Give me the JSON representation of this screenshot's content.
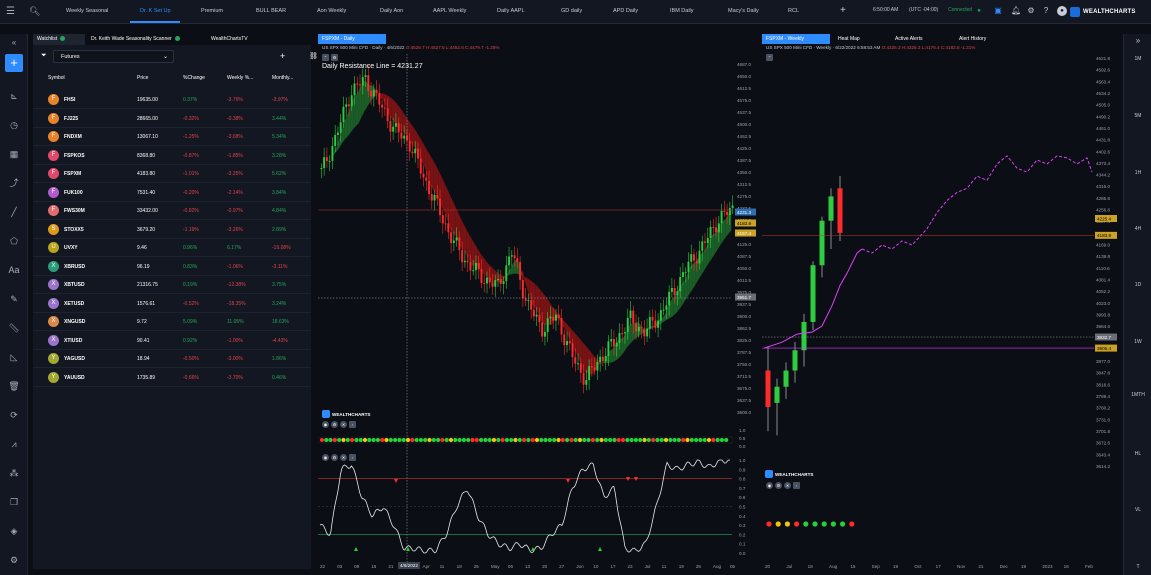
{
  "topbar": {
    "tabs": [
      {
        "label": "Weekly Seasonal",
        "active": false
      },
      {
        "label": "Dr. K Set Up",
        "active": true
      },
      {
        "label": "Premium",
        "active": false
      },
      {
        "label": "BULL BEAR",
        "active": false
      },
      {
        "label": "Aon Weekly",
        "active": false
      },
      {
        "label": "Daily Aon",
        "active": false
      },
      {
        "label": "AAPL Weekly",
        "active": false
      },
      {
        "label": "Daily AAPL",
        "active": false
      },
      {
        "label": "GD daily",
        "active": false
      },
      {
        "label": "APD Daily",
        "active": false
      },
      {
        "label": "IBM Daily",
        "active": false
      },
      {
        "label": "Macy's Daily",
        "active": false
      },
      {
        "label": "RCL",
        "active": false
      }
    ],
    "time": "6:50:00 AM",
    "timezone": "(UTC -04:00)",
    "connection": "Connected",
    "brand": "WEALTHCHARTS"
  },
  "watchlist": {
    "tabs": [
      "Watchlist",
      "Dr. Keith Wade Seasonality Scanner",
      "WealthChartsTV"
    ],
    "selector": "Futures",
    "columns": [
      "Symbol",
      "Price",
      "%Change",
      "Weekly %...",
      "Monthly..."
    ],
    "rows": [
      {
        "avatar": "F",
        "color": "#e8832a",
        "symbol": "FHSI",
        "price": "19635.00",
        "pct": "0.37%",
        "wk": "-3.76%",
        "mo": "-3.97%"
      },
      {
        "avatar": "F",
        "color": "#e8832a",
        "symbol": "FJ225",
        "price": "28665.00",
        "pct": "-0.32%",
        "wk": "-0.38%",
        "mo": "3.44%"
      },
      {
        "avatar": "F",
        "color": "#e8832a",
        "symbol": "FNDXM",
        "price": "13067.10",
        "pct": "-1.25%",
        "wk": "-3.68%",
        "mo": "5.34%"
      },
      {
        "avatar": "F",
        "color": "#e04a6a",
        "symbol": "FSPKOS",
        "price": "8368.80",
        "pct": "-0.87%",
        "wk": "-1.85%",
        "mo": "3.28%"
      },
      {
        "avatar": "F",
        "color": "#e04a6a",
        "symbol": "FSPXM",
        "price": "4183.80",
        "pct": "-1.01%",
        "wk": "-3.25%",
        "mo": "5.62%"
      },
      {
        "avatar": "F",
        "color": "#b05ccf",
        "symbol": "FUK100",
        "price": "7531.40",
        "pct": "-0.20%",
        "wk": "-2.14%",
        "mo": "3.84%"
      },
      {
        "avatar": "F",
        "color": "#e06d6d",
        "symbol": "FWS30M",
        "price": "33432.00",
        "pct": "-0.82%",
        "wk": "-0.97%",
        "mo": "4.84%"
      },
      {
        "avatar": "S",
        "color": "#d99a1e",
        "symbol": "STOXX5",
        "price": "3679.20",
        "pct": "-1.19%",
        "wk": "-3.26%",
        "mo": "2.89%"
      },
      {
        "avatar": "U",
        "color": "#b7a21a",
        "symbol": "UVXY",
        "price": "9.46",
        "pct": "0.96%",
        "wk": "6.17%",
        "mo": "-19.08%"
      },
      {
        "avatar": "X",
        "color": "#2a9c7a",
        "symbol": "XBRUSD",
        "price": "96.19",
        "pct": "0.83%",
        "wk": "-1.06%",
        "mo": "-3.11%"
      },
      {
        "avatar": "X",
        "color": "#9a74c9",
        "symbol": "XBTUSD",
        "price": "21316.75",
        "pct": "0.19%",
        "wk": "-12.38%",
        "mo": "3.75%"
      },
      {
        "avatar": "X",
        "color": "#9a74c9",
        "symbol": "XETUSD",
        "price": "1576.61",
        "pct": "-0.52%",
        "wk": "-18.35%",
        "mo": "3.24%"
      },
      {
        "avatar": "X",
        "color": "#d98a4a",
        "symbol": "XNGUSD",
        "price": "9.72",
        "pct": "5.09%",
        "wk": "11.05%",
        "mo": "18.63%"
      },
      {
        "avatar": "X",
        "color": "#9a74c9",
        "symbol": "XTIUSD",
        "price": "90.41",
        "pct": "0.92%",
        "wk": "-1.00%",
        "mo": "-4.43%"
      },
      {
        "avatar": "Y",
        "color": "#a2a832",
        "symbol": "YAGUSD",
        "price": "18.94",
        "pct": "-0.50%",
        "wk": "-3.00%",
        "mo": "1.86%"
      },
      {
        "avatar": "Y",
        "color": "#a2a832",
        "symbol": "YAUUSD",
        "price": "1735.89",
        "pct": "-0.66%",
        "wk": "-3.70%",
        "mo": "0.46%"
      }
    ]
  },
  "chart1": {
    "tab": "FSPXM - Daily",
    "subtitle": "US SPX 500 Mini CFD",
    "interval": "· Daily · 4/6/2022",
    "ohlc": "O:4526.7  H:4527.5  L:4452.6  C:4479.7  -1.25%",
    "annotation": "Daily Resistance Line = 4231.27",
    "brand": "WEALTHCHARTS",
    "y_ticks": [
      "4687.0",
      "4650.0",
      "4612.5",
      "4575.0",
      "4537.5",
      "4500.0",
      "4462.5",
      "4425.0",
      "4387.5",
      "4350.0",
      "4312.5",
      "4275.0",
      "4237.5",
      "4200.0",
      "4162.5",
      "4125.0",
      "4087.5",
      "4050.0",
      "4012.5",
      "3975.0",
      "3937.5",
      "3900.0",
      "3862.5",
      "3825.0",
      "3787.5",
      "3750.0",
      "3712.5",
      "3675.0",
      "3637.5",
      "3600.0"
    ],
    "price_tags": [
      "4231.3",
      "4183.8",
      "4157.4",
      "3951.7"
    ],
    "x_ticks": [
      "22",
      "03",
      "09",
      "15",
      "21",
      "28",
      "Apr",
      "11",
      "18",
      "25",
      "May",
      "06",
      "13",
      "20",
      "27",
      "Jun",
      "10",
      "17",
      "23",
      "Jul",
      "11",
      "19",
      "25",
      "Aug",
      "05"
    ],
    "crosshair_date": "4/6/2022",
    "osc1_scale": [
      "1.0",
      "0.5",
      "0.0"
    ],
    "osc2_scale": [
      "1.0",
      "0.9",
      "0.8",
      "0.7",
      "0.6",
      "0.5",
      "0.4",
      "0.3",
      "0.2",
      "0.1",
      "0.0"
    ]
  },
  "chart2": {
    "tab": "FSPXM - Weekly",
    "other_tabs": [
      "Heat Map",
      "Active Alerts",
      "Alert History"
    ],
    "subtitle": "US SPX 500 Mini CFD",
    "interval": "· Weekly · 6/22/2022 6:58:53 AM",
    "ohlc": "O:4325.3  H:4325.3  L:4176.4  C:4183.8  -1.31%",
    "brand": "WEALTHCHARTS",
    "y_ticks": [
      "4621.8",
      "4592.6",
      "4563.4",
      "4534.2",
      "4505.0",
      "4490.2",
      "4461.0",
      "4431.8",
      "4402.6",
      "4373.4",
      "4344.2",
      "4315.0",
      "4285.8",
      "4256.6",
      "4227.4",
      "4198.2",
      "4169.0",
      "4139.8",
      "4110.6",
      "4081.4",
      "4052.2",
      "4023.0",
      "3993.8",
      "3964.6",
      "3935.4",
      "3906.2",
      "3877.0",
      "3847.8",
      "3818.6",
      "3789.4",
      "3760.2",
      "3731.0",
      "3701.8",
      "3672.6",
      "3643.4",
      "3614.2"
    ],
    "price_tags": [
      "4225.4",
      "4183.8",
      "3932.7",
      "3905.4"
    ],
    "x_ticks": [
      "20",
      "Jul",
      "18",
      "Aug",
      "15",
      "Sep",
      "19",
      "Oct",
      "17",
      "Nov",
      "21",
      "Dec",
      "19",
      "2023",
      "16",
      "Feb"
    ]
  },
  "right_intervals": [
    "1M",
    "5M",
    "1H",
    "4H",
    "1D",
    "1W",
    "1MTH",
    "HL",
    "VL",
    "T"
  ]
}
